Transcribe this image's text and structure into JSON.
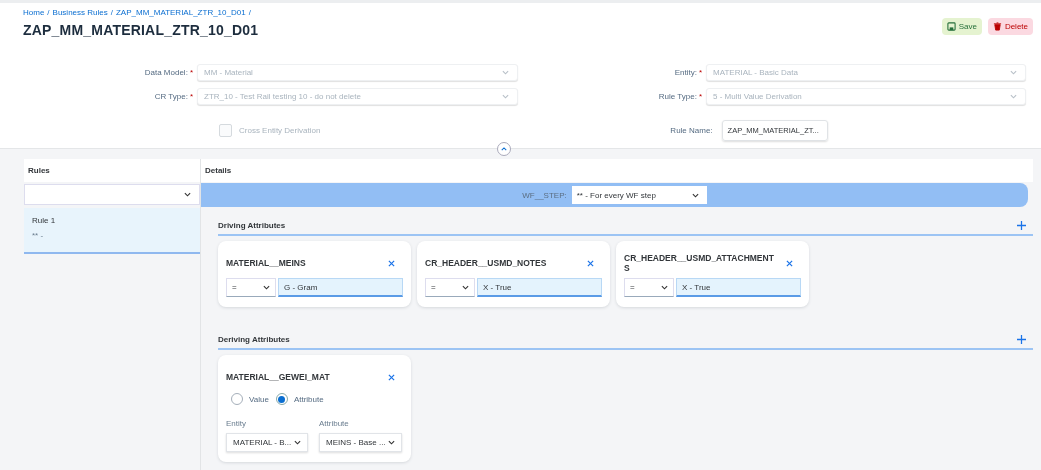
{
  "breadcrumb": {
    "separator": "/",
    "items": [
      "Home",
      "Business Rules",
      "ZAP_MM_MATERIAL_ZTR_10_D01"
    ]
  },
  "title": "ZAP_MM_MATERIAL_ZTR_10_D01",
  "actions": [
    {
      "kind": "save",
      "label": "Save"
    },
    {
      "kind": "delete",
      "label": "Delete"
    }
  ],
  "form": {
    "left": [
      {
        "label": "Data Model:",
        "required_mark": "*",
        "value": "MM - Material",
        "disabled": true
      },
      {
        "label": "CR Type:",
        "required_mark": "*",
        "value": "ZTR_10 - Test Rail testing 10 - do not delete",
        "disabled": true
      }
    ],
    "right": [
      {
        "label": "Entity:",
        "required_mark": "*",
        "value": "MATERIAL - Basic Data",
        "disabled": true
      },
      {
        "label": "Rule Type:",
        "required_mark": "*",
        "value": "5 - Multi Value Derivation",
        "disabled": true
      }
    ],
    "checkbox": {
      "label": "Cross Entity Derivation",
      "checked": false,
      "disabled": true
    },
    "rule_name": {
      "label": "Rule Name:",
      "value": "ZAP_MM_MATERIAL_ZT..."
    }
  },
  "rules": {
    "title": "Rules",
    "items": [
      {
        "name": "Rule 1",
        "subtitle": "** -",
        "selected": true
      }
    ]
  },
  "details": {
    "title": "Details",
    "step": {
      "label": "WF__STEP:",
      "value": "** - For every WF step"
    },
    "driving": {
      "title": "Driving Attributes",
      "cards": [
        {
          "name": "MATERIAL__MEINS",
          "operator": "=",
          "value": "G - Gram"
        },
        {
          "name": "CR_HEADER__USMD_NOTES",
          "operator": "=",
          "value": "X -  True"
        },
        {
          "name": "CR_HEADER__USMD_ATTACHMENTS",
          "operator": "=",
          "value": "X -  True"
        }
      ]
    },
    "deriving": {
      "title": "Deriving Attributes",
      "cards": [
        {
          "name": "MATERIAL__GEWEI_MAT",
          "options": [
            {
              "label": "Value",
              "selected": false
            },
            {
              "label": "Attribute",
              "selected": true
            }
          ],
          "entity": {
            "label": "Entity",
            "value": "MATERIAL - B..."
          },
          "attribute": {
            "label": "Attribute",
            "value": "MEINS - Base ..."
          }
        }
      ]
    }
  }
}
